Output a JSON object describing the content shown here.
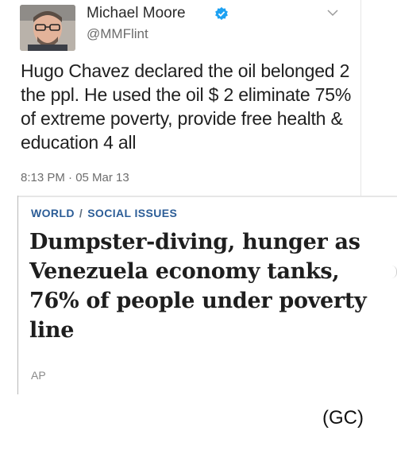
{
  "tweet": {
    "display_name": "Michael Moore",
    "handle": "@MMFlint",
    "text": "Hugo Chavez declared the oil belonged 2 the ppl. He used the oil $ 2 eliminate 75% of extreme poverty, provide free health & education 4 all",
    "timestamp": "8:13 PM · 05 Mar 13",
    "verified_icon": "verified-badge-icon",
    "menu_icon": "chevron-down-icon",
    "accent_color": "#1da1f2"
  },
  "article": {
    "section": "WORLD",
    "subsection": "SOCIAL ISSUES",
    "separator": "/",
    "headline": "Dumpster-diving, hunger as Venezuela economy tanks, 76% of people under poverty line",
    "source": "AP",
    "section_color": "#2c5d97"
  },
  "caption": "(GC)"
}
